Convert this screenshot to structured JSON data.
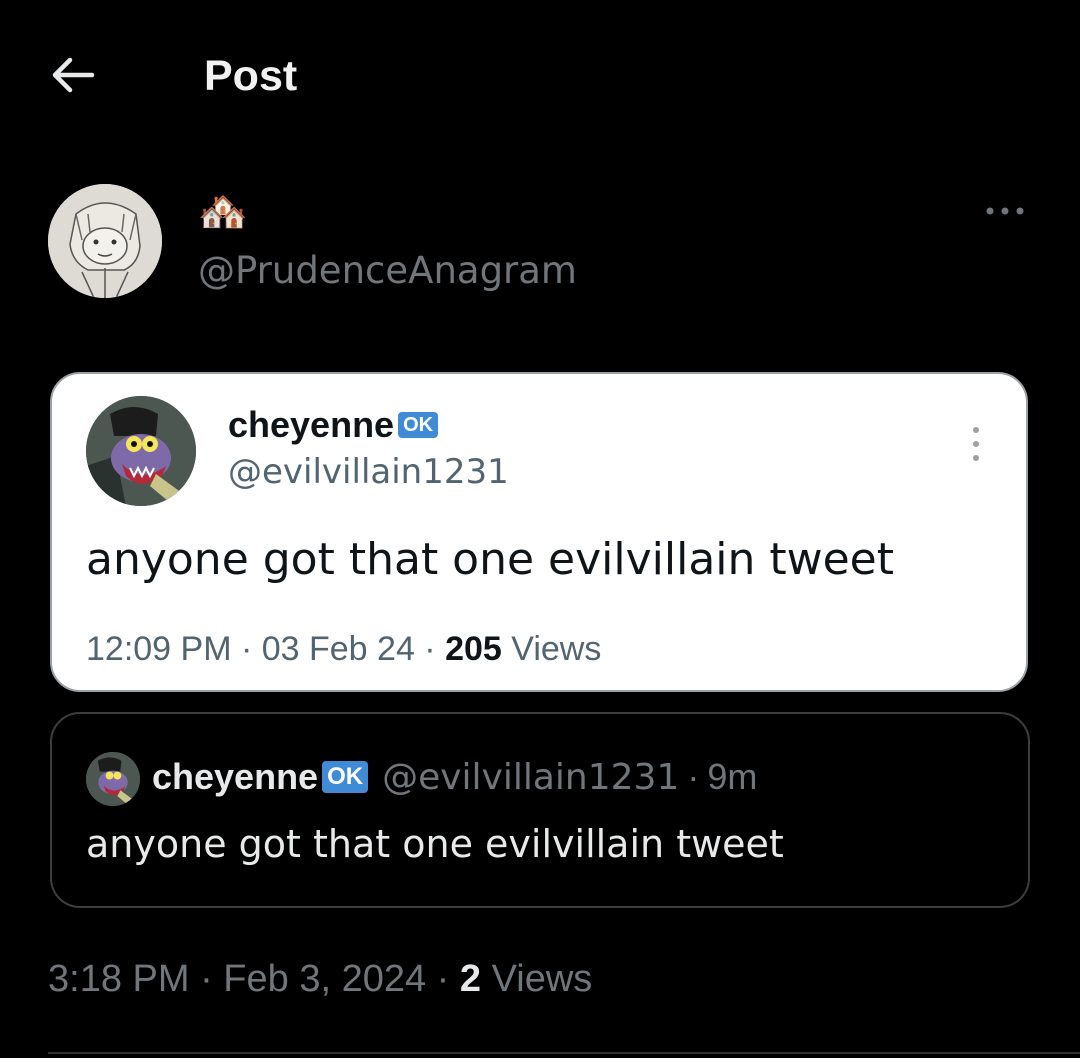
{
  "header": {
    "title": "Post"
  },
  "post": {
    "display_name_emoji": "🏘️",
    "handle": "@PrudenceAnagram",
    "timestamp": "3:18 PM · Feb 3, 2024 · ",
    "views_count": "2",
    "views_label": " Views"
  },
  "quote_image": {
    "name": "cheyenne",
    "badge": "OK",
    "handle": "@evilvillain1231",
    "text": "anyone got that one evilvillain tweet",
    "meta_prefix": "12:09 PM · 03 Feb 24 · ",
    "views_count": "205",
    "views_label": " Views"
  },
  "quoted_tweet": {
    "name": "cheyenne",
    "badge": "OK",
    "handle": "@evilvillain1231",
    "separator": "·",
    "age": "9m",
    "text": "anyone got that one evilvillain tweet"
  },
  "colors": {
    "badge": "#3f8bd6",
    "muted": "#71767b",
    "background": "#000000"
  },
  "icons": [
    "back-arrow-icon",
    "more-horizontal-icon",
    "more-vertical-icon"
  ]
}
